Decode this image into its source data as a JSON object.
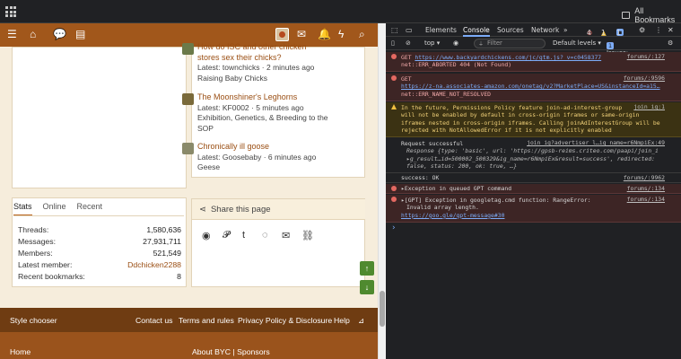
{
  "browser": {
    "bookmarks_label": "All Bookmarks"
  },
  "site_nav": {
    "icons": [
      "menu-icon",
      "home-icon",
      "chat-icon",
      "document-icon",
      "avatar",
      "mail-icon",
      "bell-icon",
      "bolt-icon",
      "search-icon"
    ]
  },
  "threads": [
    {
      "title": "How do ISC and other chicken stores sex their chicks?",
      "title_line1": "stores sex their chicks?",
      "latest": "Latest: townchicks · 2 minutes ago",
      "forum": "Raising Baby Chicks",
      "av_color": "#6b7a4a"
    },
    {
      "title": "The Moonshiner's Leghorns",
      "latest": "Latest: KF0002 · 5 minutes ago",
      "forum": "Exhibition, Genetics, & Breeding to the SOP",
      "forum_l1": "Exhibition, Genetics, & Breeding to the",
      "forum_l2": "SOP",
      "av_color": "#7a6a3a"
    },
    {
      "title": "Chronically ill goose",
      "latest": "Latest: Goosebaby · 6 minutes ago",
      "forum": "Geese",
      "av_color": "#8a8a6a"
    }
  ],
  "stats_tabs": [
    "Stats",
    "Online",
    "Recent"
  ],
  "stats": [
    {
      "label": "Threads:",
      "value": "1,580,636"
    },
    {
      "label": "Messages:",
      "value": "27,931,711"
    },
    {
      "label": "Members:",
      "value": "521,549"
    },
    {
      "label": "Latest member:",
      "value": "Ddchicken2288"
    },
    {
      "label": "Recent bookmarks:",
      "value": "8"
    }
  ],
  "share": {
    "title": "Share this page",
    "icons": [
      "reddit-icon",
      "pinterest-icon",
      "tumblr-icon",
      "whatsapp-icon",
      "email-icon",
      "link-icon"
    ]
  },
  "footer": {
    "style_chooser": "Style chooser",
    "links": [
      "Contact us",
      "Terms and rules",
      "Privacy Policy & Disclosure",
      "Help"
    ],
    "home": "Home",
    "about": "About BYC | Sponsors"
  },
  "devtools": {
    "tabs": [
      "Elements",
      "Console",
      "Sources",
      "Network",
      "»"
    ],
    "counts": {
      "errors": "4",
      "warnings": "1",
      "info": "1"
    },
    "toolbar": {
      "context": "top ▾",
      "filter_placeholder": "Filter",
      "levels": "Default levels ▾",
      "issues": "2 Issues:",
      "issue_err": "1",
      "issue_info": "1"
    },
    "messages": [
      {
        "type": "error",
        "prefix": "GET ",
        "url": "https://www.backyardchickens.com/jc/gtm.js?_v=c0458377",
        "src": "forums/:127",
        "extra": "net::ERR_ABORTED 404 (Not Found)"
      },
      {
        "type": "error",
        "prefix": "GET",
        "src": "forums/:9596",
        "url": "https://z-na.associates-amazon.com/onetag/v2?MarketPlace=US&instanceId=a15…",
        "extra": "net::ERR_NAME_NOT_RESOLVED"
      },
      {
        "type": "warning",
        "src": "join_ig:1",
        "lines": [
          "In the future, Permissions Policy feature join-ad-interest-group",
          "will not be enabled by default in cross-origin iframes or same-origin",
          "iframes nested in cross-origin iframes. Calling joinAdInterestGroup will be",
          "rejected with NotAllowedError if it is not explicitly enabled"
        ]
      },
      {
        "type": "info",
        "text": "Request successful",
        "src": "join_ig?advertiser_l…ig_name=r6NmpiEx:49",
        "obj1": "Response {type: 'basic', url: 'https://gpsb-reims.criteo.com/paapi/join_i",
        "obj2": "▸g_result…id=500002_500329&ig_name=r6NmpiEx&result=success', redirected:",
        "obj3": "false, status: 200, ok: true, …}"
      },
      {
        "type": "info",
        "text": "success: OK",
        "src": "forums/:9962"
      },
      {
        "type": "error",
        "text": "▸Exception in queued GPT command",
        "src": "forums/:134"
      },
      {
        "type": "error",
        "text": "▸[GPT] Exception in googletag.cmd function: RangeError:",
        "text2": "Invalid array length.",
        "url": "https://goo.gle/gpt-message#30",
        "src": "forums/:134"
      }
    ],
    "prompt": "›"
  }
}
